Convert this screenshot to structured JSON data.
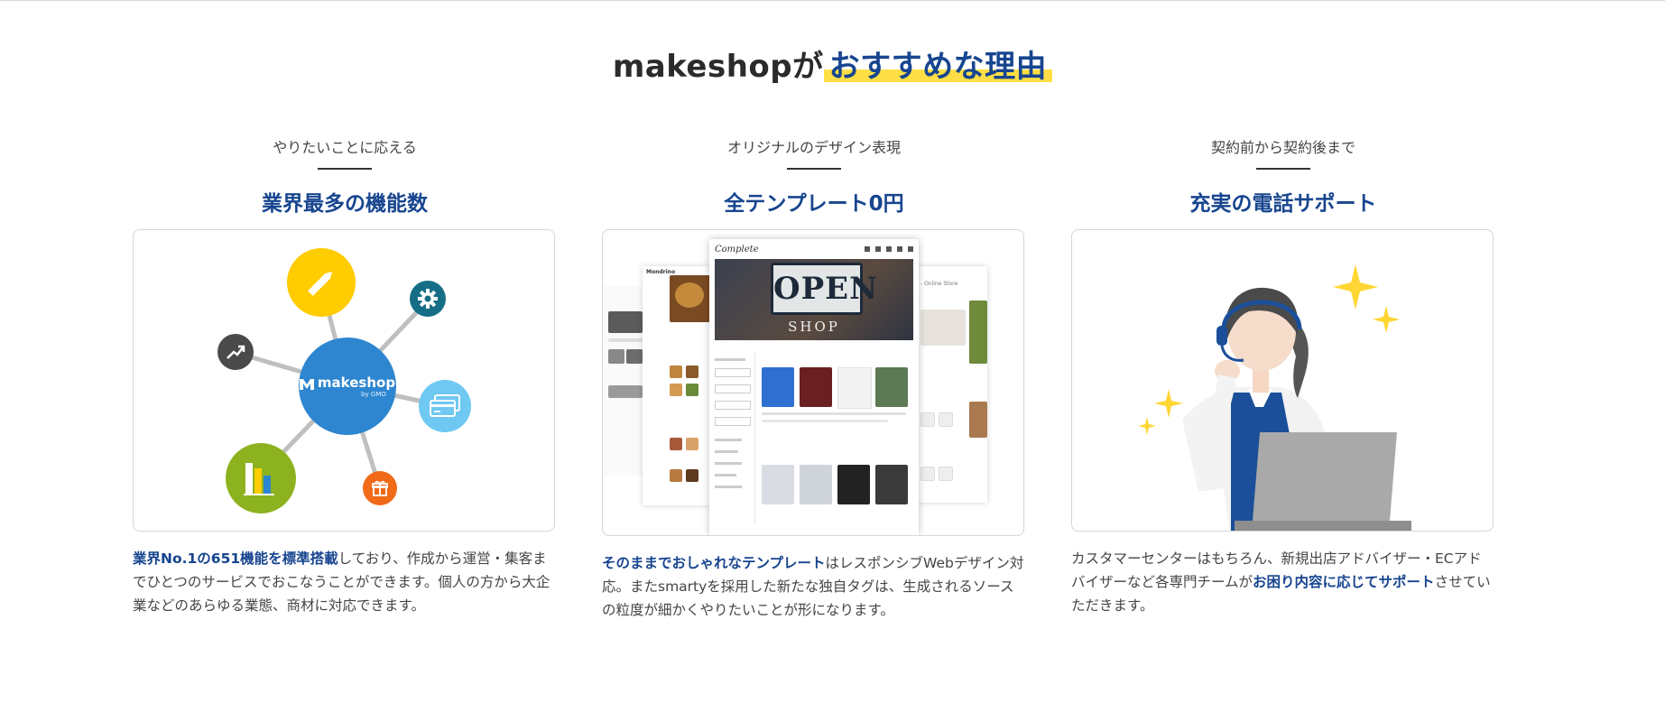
{
  "heading": {
    "brand": "makeshopが",
    "highlight": "おすすめな理由"
  },
  "colors": {
    "accent": "#17458f",
    "highlight": "#ffdf45"
  },
  "columns": [
    {
      "sub": "やりたいことに応える",
      "title": "業界最多の機能数",
      "desc": [
        {
          "text": "業界No.1の651機能を標準搭載",
          "strong": true
        },
        {
          "text": "しており、作成から運営・集客までひとつのサービスでおこなうことができます。個人の方から大企業などのあらゆる業態、商材に対応できます。",
          "strong": false
        }
      ],
      "illustration": {
        "hub_logo": "makeshop",
        "hub_sub": "by GMO",
        "icons": [
          "pencil-icon",
          "gear-icon",
          "trend-icon",
          "card-icon",
          "bar-chart-icon",
          "gift-icon"
        ]
      }
    },
    {
      "sub": "オリジナルのデザイン表現",
      "title": "全テンプレート0円",
      "desc": [
        {
          "text": "そのままでおしゃれなテンプレート",
          "strong": true
        },
        {
          "text": "はレスポンシブWebデザイン対応。またsmartyを採用した新たな独自タグは、生成されるソースの粒度が細かくやりたいことが形になります。",
          "strong": false
        }
      ],
      "illustration": {
        "store_logo": "Complete",
        "left_logo": "Mondrino",
        "right_label": "- Online Store",
        "sign_main": "OPEN",
        "sign_sub": "SHOP"
      }
    },
    {
      "sub": "契約前から契約後まで",
      "title": "充実の電話サポート",
      "desc": [
        {
          "text": "カスタマーセンターはもちろん、新規出店アドバイザー・ECアドバイザーなど各専門チームが",
          "strong": false
        },
        {
          "text": "お困り内容に応じてサポート",
          "strong": true
        },
        {
          "text": "させていただきます。",
          "strong": false
        }
      ],
      "illustration": {
        "icons": [
          "sparkle-icon",
          "headset-icon",
          "laptop-icon"
        ]
      }
    }
  ]
}
